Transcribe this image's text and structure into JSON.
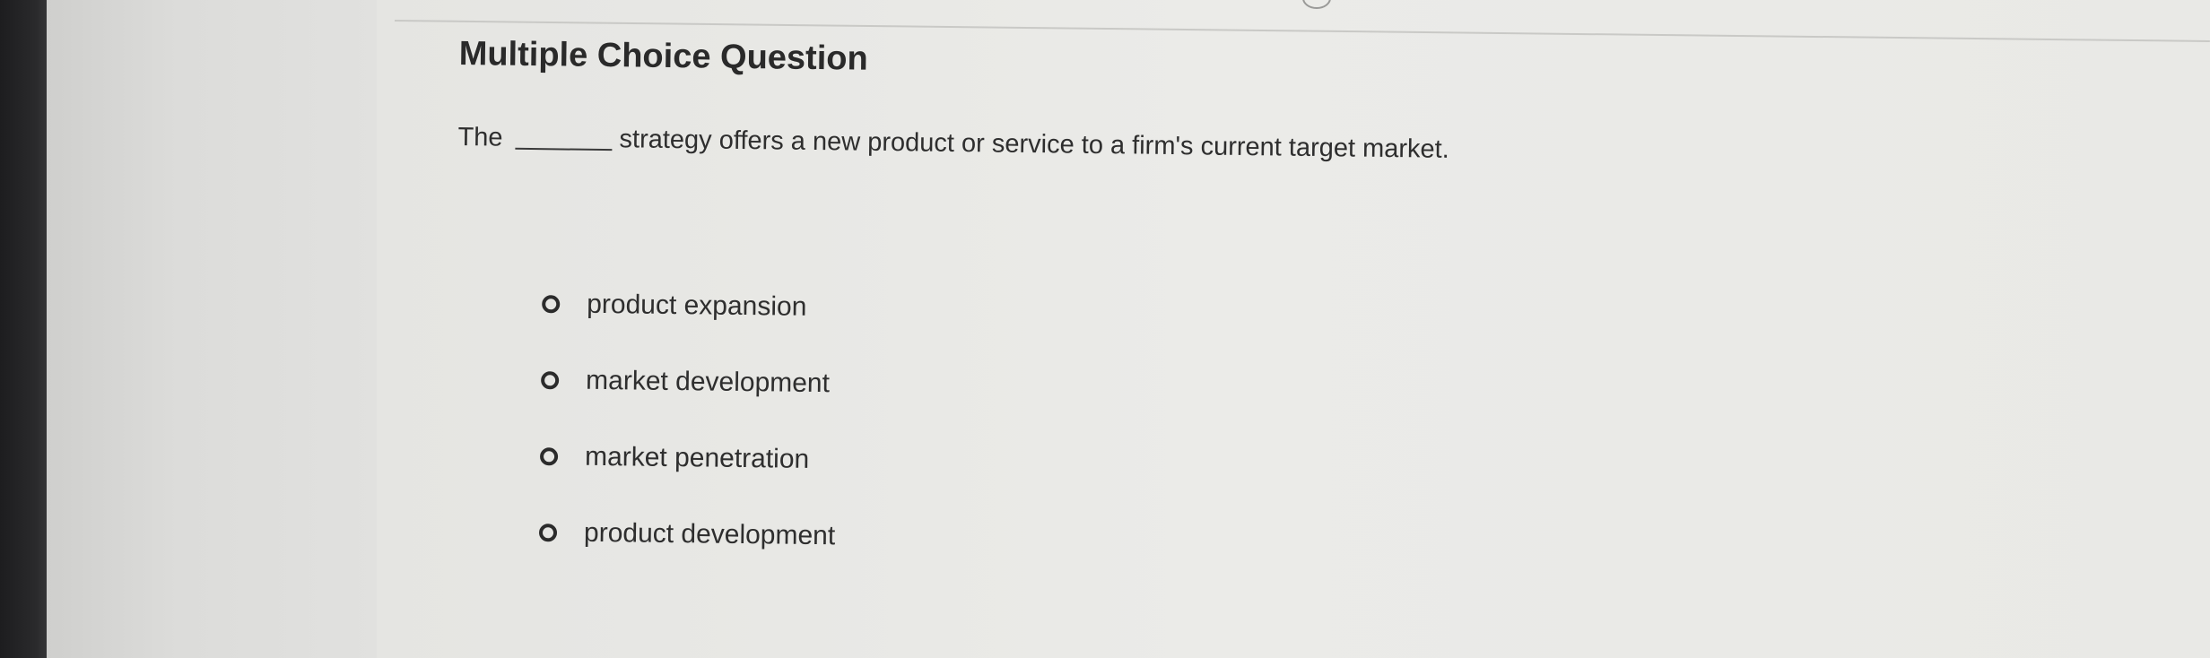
{
  "question": {
    "title": "Multiple Choice Question",
    "text_before_blank": "The",
    "text_after_blank": "strategy offers a new product or service to a firm's current target market."
  },
  "options": [
    {
      "label": "product expansion"
    },
    {
      "label": "market development"
    },
    {
      "label": "market penetration"
    },
    {
      "label": "product development"
    }
  ],
  "colors": {
    "text": "#2b2b2b",
    "background": "#e9e9e6",
    "bezel": "#1d1d1f"
  }
}
